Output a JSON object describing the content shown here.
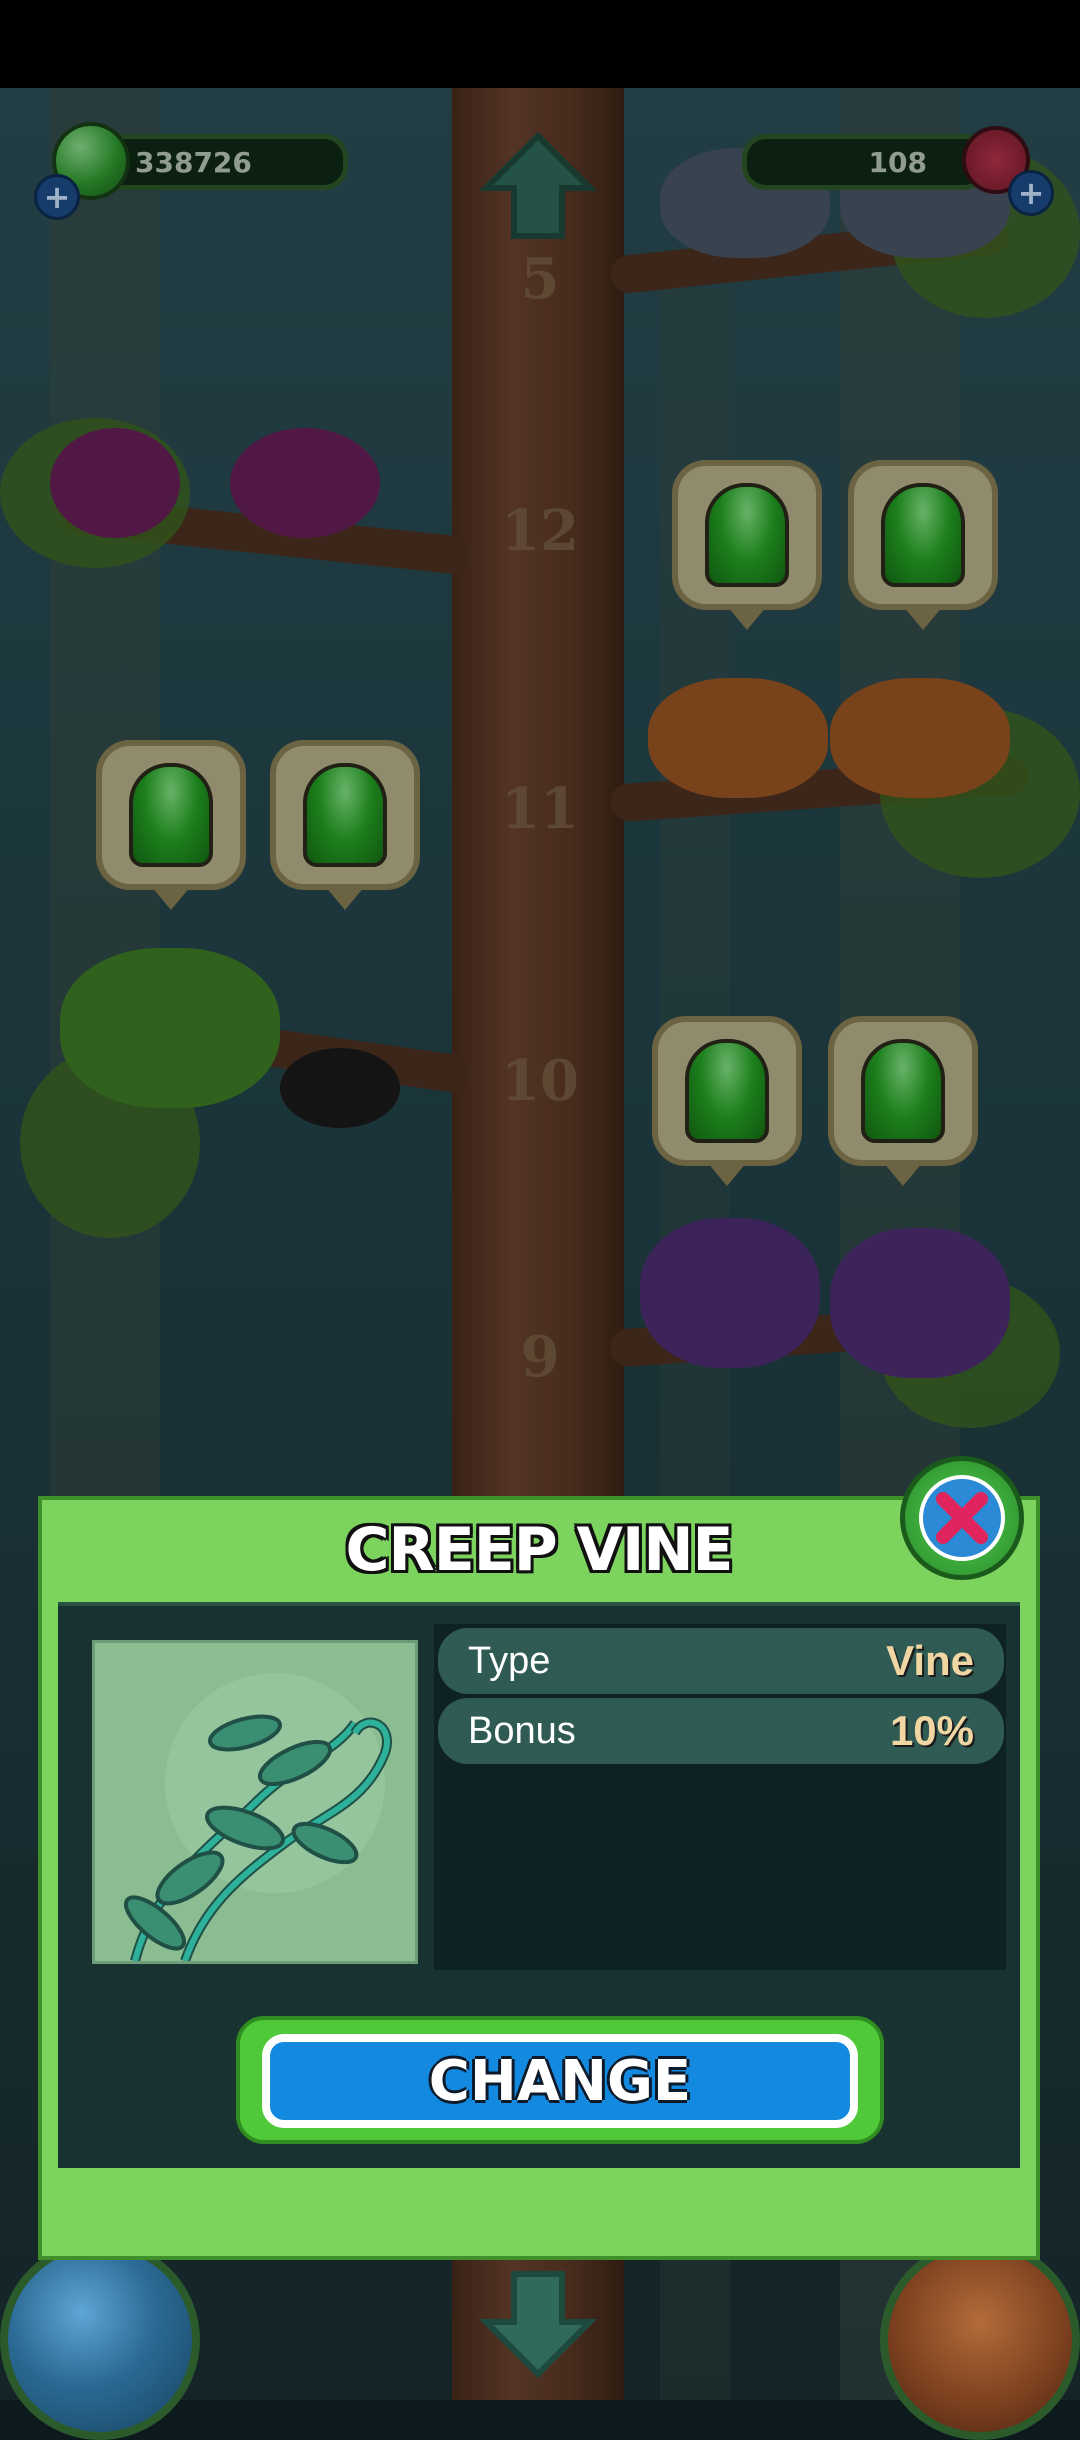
{
  "hud": {
    "gems_count": "338726",
    "flowers_count": "108",
    "gem_icon": "green-gem-icon",
    "flower_icon": "red-flower-icon",
    "plus_icon": "plus-icon"
  },
  "floors": [
    "5",
    "12",
    "11",
    "10",
    "9"
  ],
  "dialog": {
    "title": "CREEP VINE",
    "preview_icon": "vine-icon",
    "stats": [
      {
        "label": "Type",
        "value": "Vine"
      },
      {
        "label": "Bonus",
        "value": "10%"
      }
    ],
    "change_label": "CHANGE",
    "close_icon": "close-x-icon"
  },
  "colors": {
    "dialog_green": "#7cd35e",
    "panel_dark": "#173230",
    "stat_row": "#2f5b54",
    "button_blue": "#1489e0",
    "value_text": "#f0d6a3"
  }
}
